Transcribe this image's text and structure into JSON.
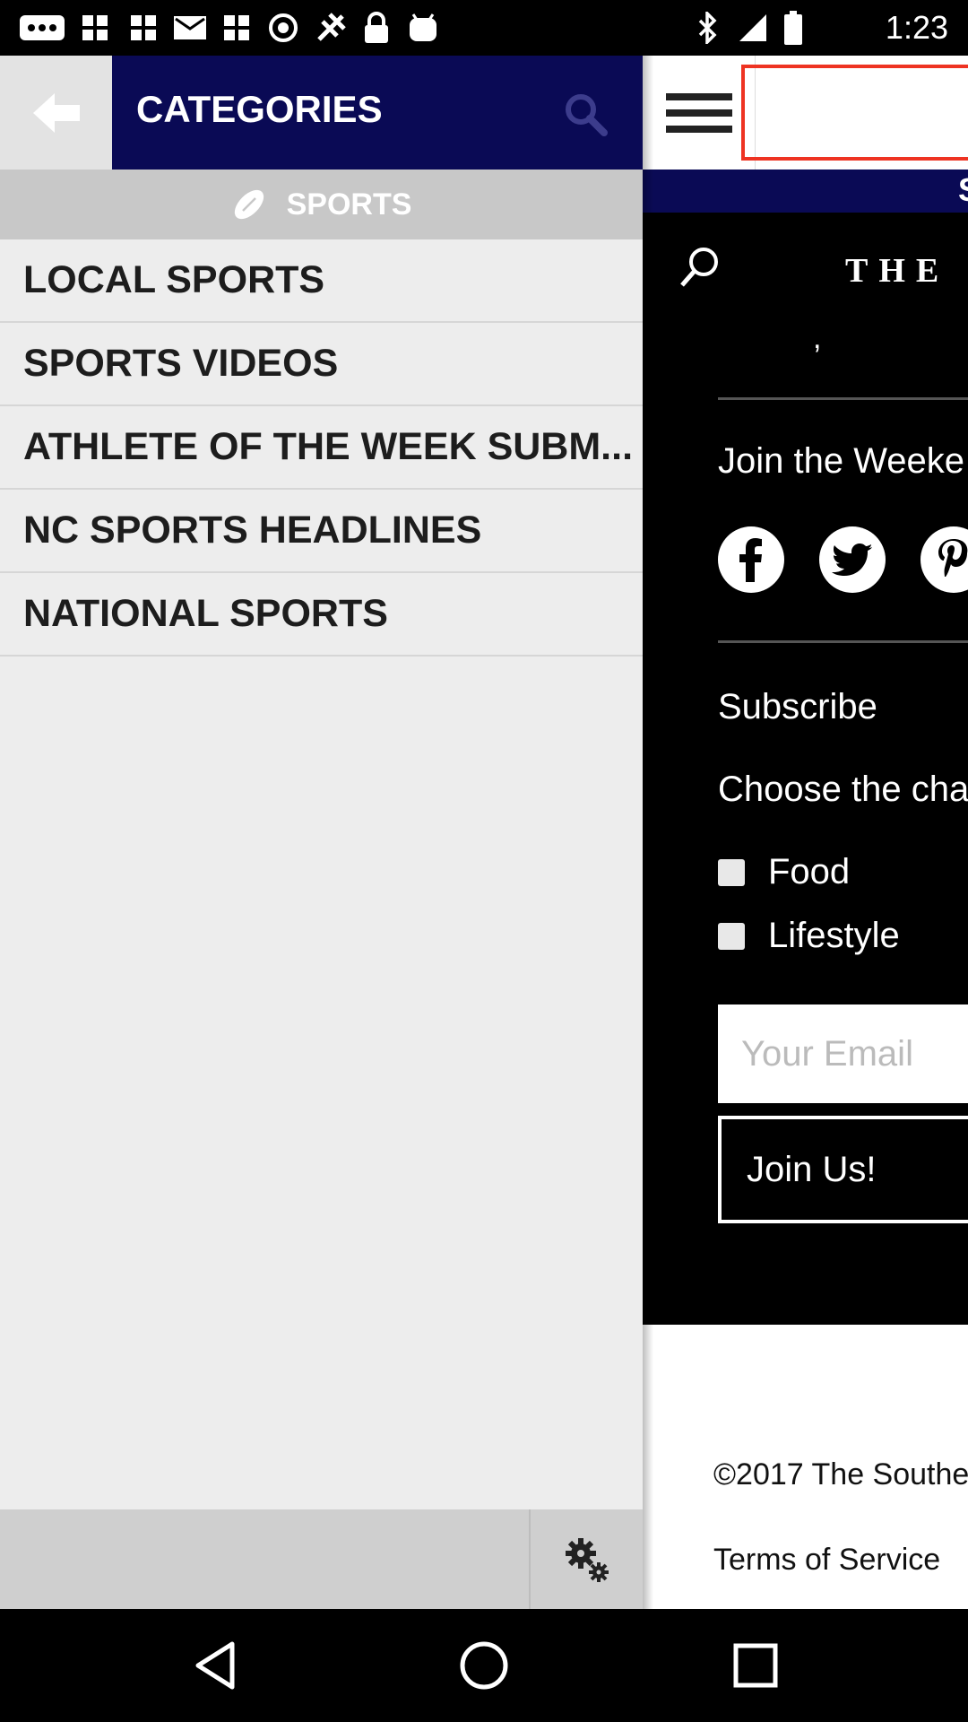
{
  "status_bar": {
    "time": "1:23",
    "icons": [
      "messages-icon",
      "image-icon",
      "fan-icon",
      "mail-icon",
      "fan-icon",
      "circle-icon",
      "fake-gps-icon",
      "lock-icon",
      "android-icon",
      "bluetooth-icon",
      "signal-icon",
      "battery-icon"
    ]
  },
  "drawer": {
    "title": "CATEGORIES",
    "section": {
      "label": "SPORTS",
      "icon": "football-icon"
    },
    "items": [
      {
        "label": "LOCAL SPORTS"
      },
      {
        "label": "SPORTS VIDEOS"
      },
      {
        "label": "ATHLETE OF THE WEEK SUBM..."
      },
      {
        "label": "NC SPORTS HEADLINES"
      },
      {
        "label": "NATIONAL SPORTS"
      }
    ],
    "colors": {
      "header": "#0a0a55",
      "background": "#ededed",
      "section": "#c8c8c8"
    }
  },
  "page": {
    "band_text": "S",
    "brand": "THE S",
    "brand_mark": ",",
    "join_heading": "Join the Weeke",
    "social": [
      "facebook-icon",
      "twitter-icon",
      "pinterest-icon"
    ],
    "subscribe": "Subscribe",
    "choose": "Choose the cha",
    "options": [
      {
        "label": "Food"
      },
      {
        "label": "Lifestyle"
      }
    ],
    "email_placeholder": "Your Email",
    "join_button": "Join Us!",
    "copyright": "©2017 The Southe",
    "terms": "Terms of Service",
    "highlight_color": "#ee3322"
  },
  "nav": {
    "buttons": [
      "back-icon",
      "home-icon",
      "recents-icon"
    ]
  }
}
